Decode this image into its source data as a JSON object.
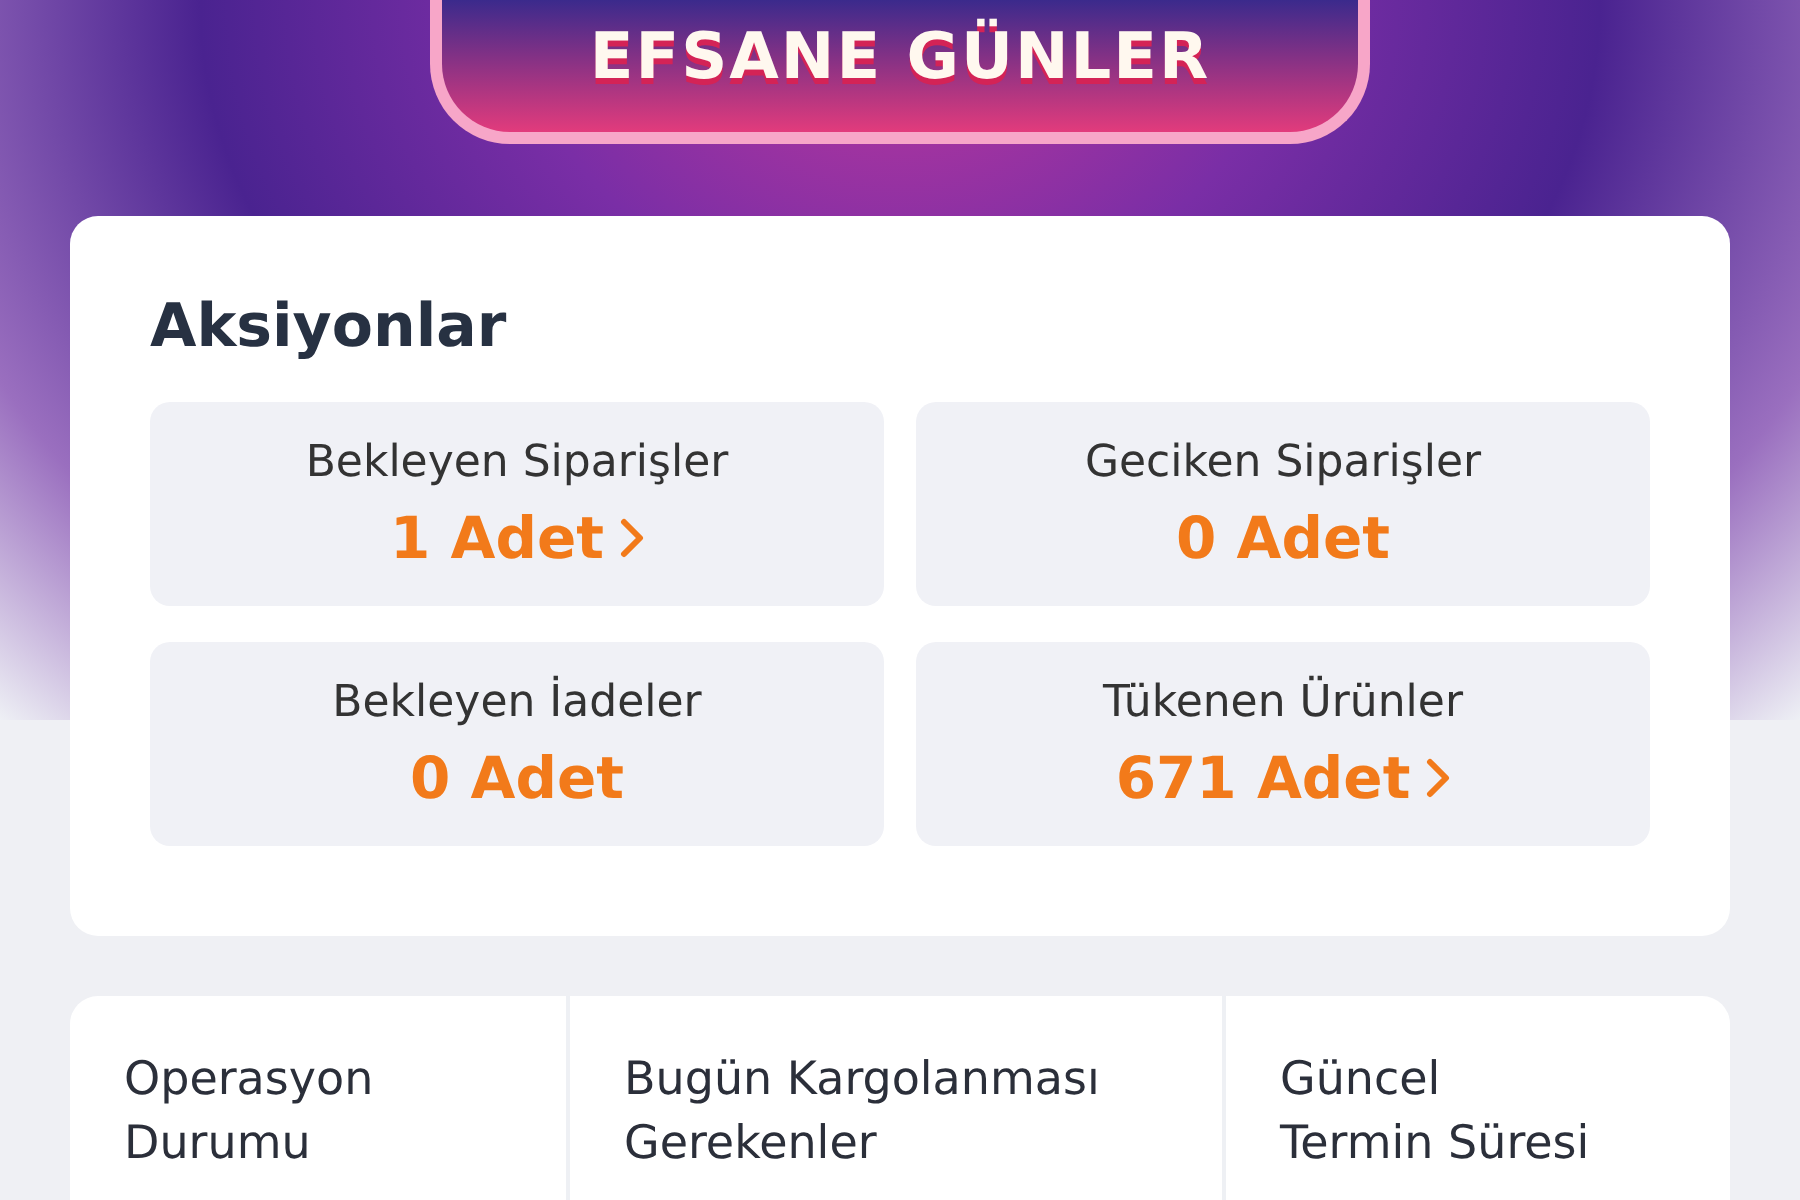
{
  "banner": {
    "title": "EFSANE GÜNLER"
  },
  "actions": {
    "title": "Aksiyonlar",
    "items": [
      {
        "label": "Bekleyen Siparişler",
        "value": "1 Adet",
        "link": true
      },
      {
        "label": "Geciken Siparişler",
        "value": "0 Adet",
        "link": false
      },
      {
        "label": "Bekleyen İadeler",
        "value": "0 Adet",
        "link": false
      },
      {
        "label": "Tükenen Ürünler",
        "value": "671 Adet",
        "link": true
      }
    ]
  },
  "stats": [
    {
      "label": "Operasyon Durumu"
    },
    {
      "label": "Bugün Kargolanması Gerekenler"
    },
    {
      "label": "Güncel Termin Süresi"
    }
  ]
}
